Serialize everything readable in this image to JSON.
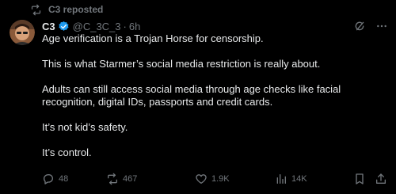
{
  "repost_banner": {
    "text": "C3 reposted"
  },
  "author": {
    "name": "C3",
    "handle": "@C_3C_3",
    "separator": "·",
    "time": "6h"
  },
  "post": {
    "paragraphs": [
      "Age verification is a Trojan Horse for censorship.",
      "This is what Starmer’s social media restriction is really about.",
      "Adults can still access social media through age checks like facial recognition, digital IDs, passports and credit cards.",
      "It’s not kid’s safety.",
      "It’s control."
    ]
  },
  "actions": {
    "replies": "48",
    "reposts": "467",
    "likes": "1.9K",
    "views": "14K"
  },
  "icons": {
    "repost": "repost-icon",
    "verified": "verified-badge-icon",
    "grok": "grok-icon",
    "more": "more-options-icon",
    "reply": "reply-icon",
    "like": "heart-icon",
    "views": "views-chart-icon",
    "bookmark": "bookmark-icon",
    "share": "share-icon"
  },
  "colors": {
    "background": "#000000",
    "text": "#e7e9ea",
    "muted": "#71767b",
    "verified": "#1d9bf0"
  }
}
